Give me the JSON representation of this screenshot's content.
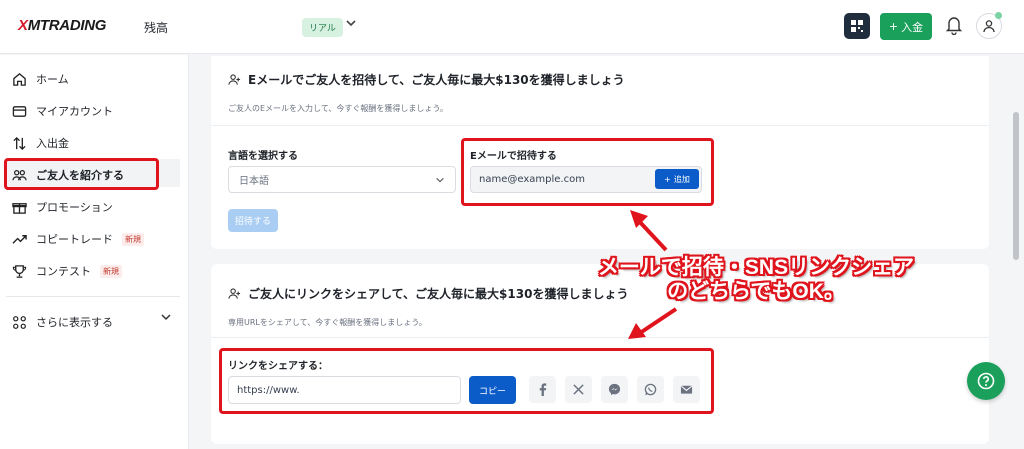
{
  "header": {
    "logo_prefix": "X",
    "logo_rest": "MTRADING",
    "balance_label": "残高",
    "account_badge": "リアル",
    "deposit_label": "入金"
  },
  "sidebar": {
    "items": [
      {
        "label": "ホーム",
        "icon": "home-icon"
      },
      {
        "label": "マイアカウント",
        "icon": "wallet-icon"
      },
      {
        "label": "入出金",
        "icon": "transfer-icon"
      },
      {
        "label": "ご友人を紹介する",
        "icon": "users-icon"
      },
      {
        "label": "プロモーション",
        "icon": "gift-icon"
      },
      {
        "label": "コピートレード",
        "icon": "trend-icon",
        "badge": "新規"
      },
      {
        "label": "コンテスト",
        "icon": "trophy-icon",
        "badge": "新規"
      }
    ],
    "more_label": "さらに表示する"
  },
  "email_card": {
    "title": "Eメールでご友人を招待して、ご友人毎に最大$130を獲得しましょう",
    "subtitle": "ご友人のEメールを入力して、今すぐ報酬を獲得しましょう。",
    "language_label": "言語を選択する",
    "language_value": "日本語",
    "email_label": "Eメールで招待する",
    "email_placeholder": "name@example.com",
    "add_label": "追加",
    "invite_label": "招待する"
  },
  "link_card": {
    "title": "ご友人にリンクをシェアして、ご友人毎に最大$130を獲得しましょう",
    "subtitle": "専用URLをシェアして、今すぐ報酬を獲得しましょう。",
    "share_label": "リンクをシェアする：",
    "link_value": "https://www.",
    "copy_label": "コピー",
    "social_icons": [
      "facebook-icon",
      "x-icon",
      "messenger-icon",
      "whatsapp-icon",
      "email-icon"
    ]
  },
  "annotation": {
    "line1": "メールで招待・SNSリンクシェア",
    "line2": "のどちらでもOK。",
    "color": "#e0141c"
  },
  "colors": {
    "accent_green": "#1aa05b",
    "primary_blue": "#0b5cc8"
  }
}
